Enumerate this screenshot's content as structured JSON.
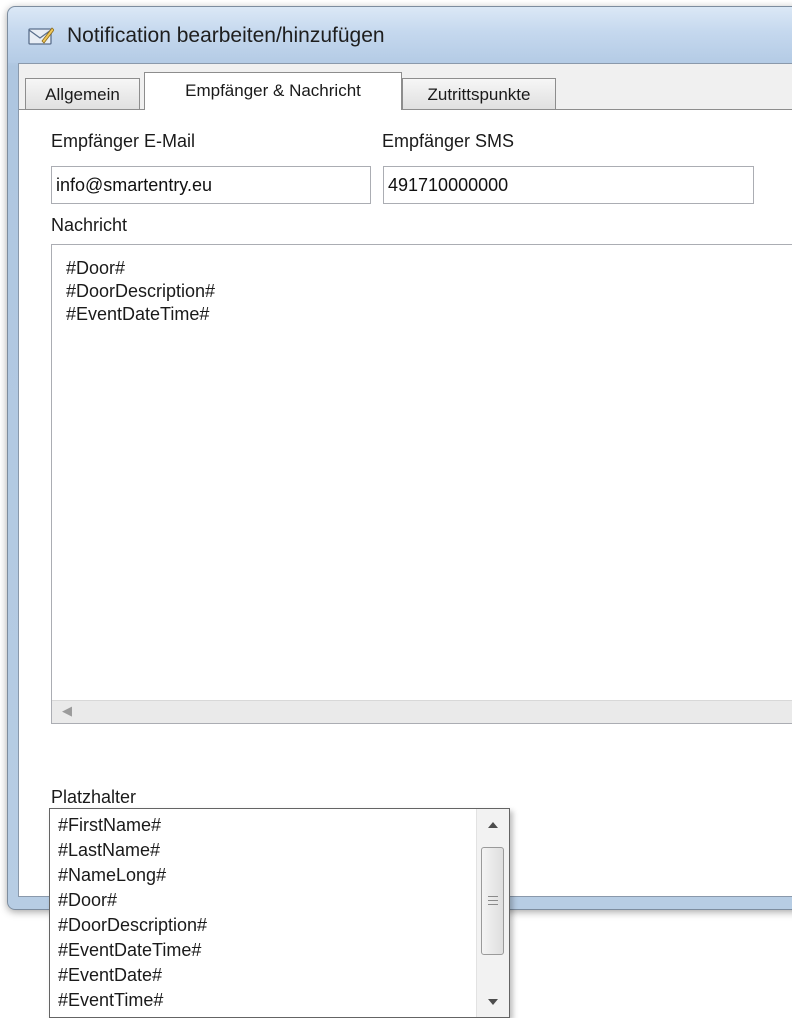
{
  "window": {
    "title": "Notification bearbeiten/hinzufügen",
    "icon": "envelope-edit-icon"
  },
  "tabs": [
    {
      "label": "Allgemein",
      "active": false
    },
    {
      "label": "Empfänger & Nachricht",
      "active": true
    },
    {
      "label": "Zutrittspunkte",
      "active": false
    }
  ],
  "form": {
    "email_label": "Empfänger E-Mail",
    "email_value": "info@smartentry.eu",
    "sms_label": "Empfänger SMS",
    "sms_value": "491710000000",
    "message_label": "Nachricht",
    "message_lines": [
      "#Door#",
      "#DoorDescription#",
      "#EventDateTime#"
    ],
    "placeholder_label": "Platzhalter",
    "placeholder_selected": ""
  },
  "dropdown": {
    "options": [
      "#FirstName#",
      "#LastName#",
      "#NameLong#",
      "#Door#",
      "#DoorDescription#",
      "#EventDateTime#",
      "#EventDate#",
      "#EventTime#"
    ]
  },
  "colors": {
    "combo_border": "#3c7fb1",
    "window_frame": "#b6cde6"
  }
}
